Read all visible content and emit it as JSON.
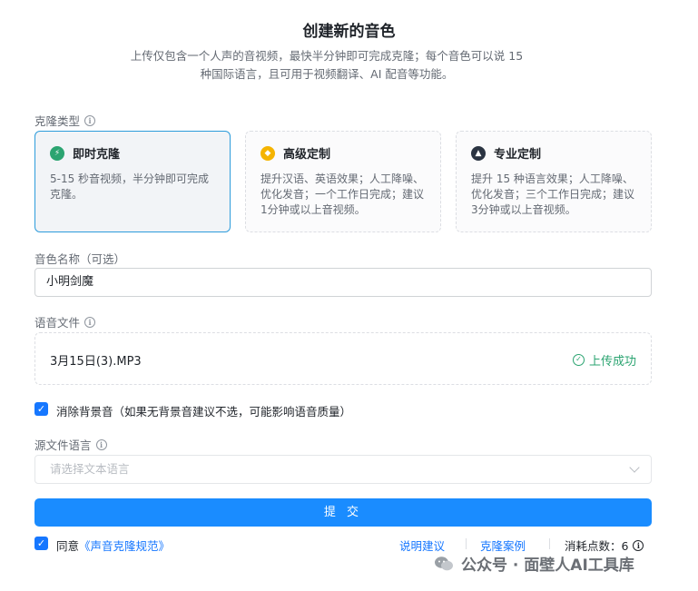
{
  "header": {
    "title": "创建新的音色",
    "subtitle_line1": "上传仅包含一个人声的音视频，最快半分钟即可完成克隆；每个音色可以说 15",
    "subtitle_line2": "种国际语言，且可用于视频翻译、AI 配音等功能。"
  },
  "clone_type": {
    "label": "克隆类型",
    "options": [
      {
        "name": "即时克隆",
        "desc": "5-15 秒音视频，半分钟即可完成克隆。",
        "icon": "lightning-icon",
        "color": "#2ba471",
        "selected": true
      },
      {
        "name": "高级定制",
        "desc": "提升汉语、英语效果；人工降噪、优化发音；一个工作日完成；建议1分钟或以上音视频。",
        "icon": "badge-icon",
        "color": "#f5b400",
        "selected": false
      },
      {
        "name": "专业定制",
        "desc": "提升 15 种语言效果；人工降噪、优化发音；三个工作日完成；建议3分钟或以上音视频。",
        "icon": "sail-icon",
        "color": "#2b3442",
        "selected": false
      }
    ]
  },
  "voice_name": {
    "label": "音色名称（可选）",
    "value": "小明剑魔"
  },
  "audio_file": {
    "label": "语音文件",
    "file_name": "3月15日(3).MP3",
    "status": "上传成功"
  },
  "remove_bg": {
    "checked": true,
    "text": "消除背景音（如果无背景音建议不选，可能影响语音质量）"
  },
  "source_lang": {
    "label": "源文件语言",
    "placeholder": "请选择文本语言"
  },
  "submit_label": "提 交",
  "footer": {
    "agree_prefix": "同意",
    "agree_link": "《声音克隆规范》",
    "guide_link": "说明建议",
    "cases_link": "克隆案例",
    "cost_text": "消耗点数：6"
  },
  "watermark": "公众号 · 面壁人AI工具库"
}
